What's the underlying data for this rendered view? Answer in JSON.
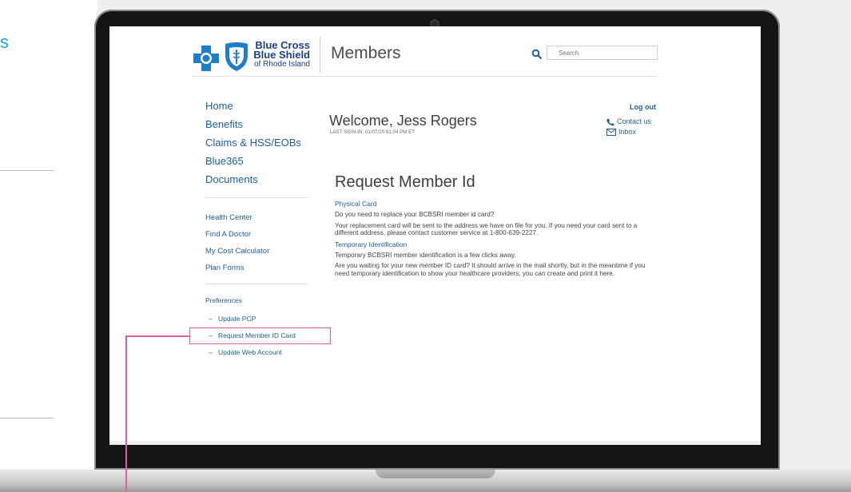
{
  "left_panel": {
    "heading_letter": "s"
  },
  "header": {
    "logo_line1": "Blue Cross",
    "logo_line2": "Blue Shield",
    "logo_line3": "of Rhode Island",
    "section_title": "Members",
    "search_placeholder": "Search"
  },
  "nav_main": [
    "Home",
    "Benefits",
    "Claims & HSS/EOBs",
    "Blue365",
    "Documents"
  ],
  "nav_secondary": [
    "Health Center",
    "Find A Doctor",
    "My Cost Calculator",
    "Plan Forms"
  ],
  "preferences": {
    "title": "Preferences",
    "items": [
      "Update PCP",
      "Request Member ID Card",
      "Update Web Account"
    ],
    "dash": "–"
  },
  "welcome": {
    "greeting": "Welcome, Jess Rogers",
    "last_signin": "LAST SIGN-IN: 01/07/20 01:04 PM ET"
  },
  "account_links": {
    "logout": "Log out",
    "contact": "Contact us",
    "inbox": "Inbox"
  },
  "content": {
    "title": "Request Member Id",
    "physical_heading": "Physical Card",
    "physical_q": "Do you need to replace your BCBSRI member id card?",
    "physical_body": "Your replacement card will be sent to the address we have on file for you. If you need your card sent to a different address, please contact customer service at 1-800-639-2227.",
    "temp_heading": "Temporary Identification",
    "temp_q": "Temporary BCBSRI member identification is a few clicks away.",
    "temp_body": "Are you waiting for your new member ID card? It should arrive in the mail shortly, but in the meantime if you need temporary identification to show your healthcare providers, you can create and print it here."
  },
  "colors": {
    "link": "#1f5f9e",
    "accent_left": "#1ba6d6",
    "callout": "#e05aa6",
    "brand_blue": "#1e3f8a"
  }
}
